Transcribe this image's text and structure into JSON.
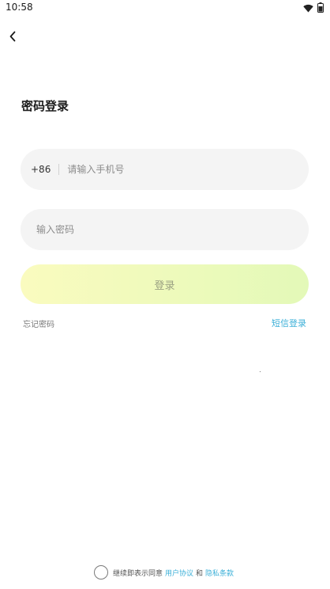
{
  "status_bar": {
    "time": "10:58",
    "icons": [
      "wifi-icon",
      "battery-icon"
    ]
  },
  "nav": {
    "back_icon": "chevron-left-icon"
  },
  "title": "密码登录",
  "phone": {
    "country_code": "+86",
    "placeholder": "请输入手机号",
    "value": ""
  },
  "password": {
    "placeholder": "输入密码",
    "value": ""
  },
  "login_label": "登录",
  "forgot_password": "忘记密码",
  "sms_login": "短信登录",
  "agreement": {
    "prefix": "继续即表示同意",
    "user_agreement": "用户协议",
    "and": "和",
    "privacy_policy": "隐私条款",
    "checked": false
  },
  "colors": {
    "accent_link": "#3db0d8",
    "button_gradient_start": "#fafbbf",
    "button_gradient_end": "#e3f9b8",
    "field_bg": "#f4f4f4"
  }
}
